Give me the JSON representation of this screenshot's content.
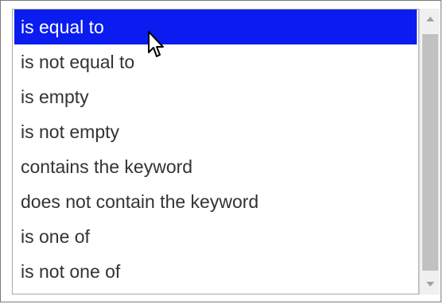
{
  "options": [
    {
      "label": "is equal to",
      "selected": true
    },
    {
      "label": "is not equal to",
      "selected": false
    },
    {
      "label": "is empty",
      "selected": false
    },
    {
      "label": "is not empty",
      "selected": false
    },
    {
      "label": "contains the keyword",
      "selected": false
    },
    {
      "label": "does not contain the keyword",
      "selected": false
    },
    {
      "label": "is one of",
      "selected": false
    },
    {
      "label": "is not one of",
      "selected": false
    }
  ],
  "colors": {
    "selected_bg": "#0a1cf0",
    "selected_text": "#ffffff",
    "text": "#333333",
    "scroll_thumb": "#c1c1c1"
  },
  "icons": {
    "scroll_up": "scroll-up-arrow-icon",
    "scroll_down": "scroll-down-arrow-icon",
    "cursor": "mouse-pointer-icon"
  }
}
